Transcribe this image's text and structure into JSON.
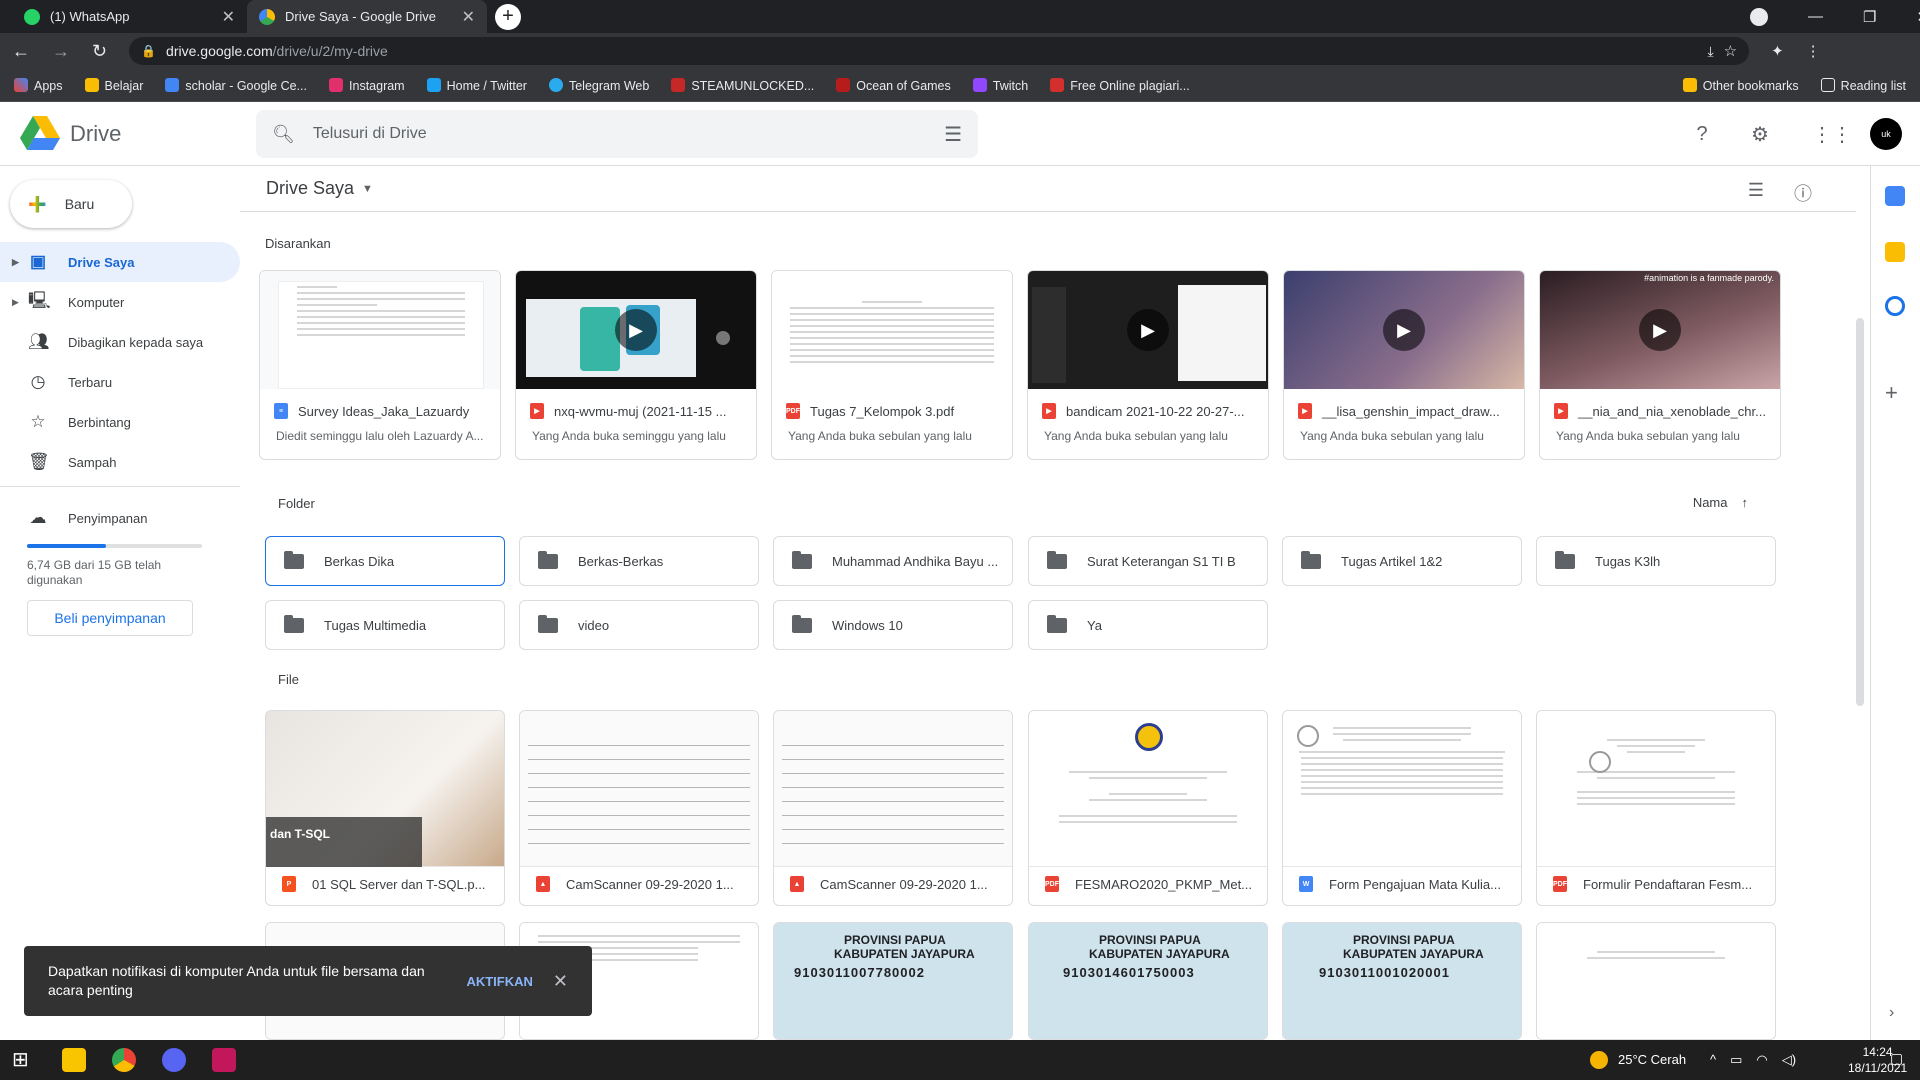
{
  "browser": {
    "tabs": [
      {
        "title": "(1) WhatsApp",
        "active": false
      },
      {
        "title": "Drive Saya - Google Drive",
        "active": true
      }
    ],
    "url_host": "drive.google.com",
    "url_path": "/drive/u/2/my-drive",
    "bookmarks": [
      "Apps",
      "Belajar",
      "scholar - Google Ce...",
      "Instagram",
      "Home / Twitter",
      "Telegram Web",
      "STEAMUNLOCKED...",
      "Ocean of Games",
      "Twitch",
      "Free Online plagiari..."
    ],
    "bookmarks_right": [
      "Other bookmarks",
      "Reading list"
    ]
  },
  "drive": {
    "app_name": "Drive",
    "search_placeholder": "Telusuri di Drive",
    "avatar_text": "uk",
    "new_label": "Baru",
    "nav": [
      "Drive Saya",
      "Komputer",
      "Dibagikan kepada saya",
      "Terbaru",
      "Berbintang",
      "Sampah"
    ],
    "storage_label": "Penyimpanan",
    "storage_text": "6,74 GB dari 15 GB telah digunakan",
    "storage_fraction": 0.45,
    "buy_label": "Beli penyimpanan",
    "crumb": "Drive Saya",
    "section_suggested": "Disarankan",
    "section_folder": "Folder",
    "section_file": "File",
    "sort_label": "Nama",
    "suggested": [
      {
        "name": "Survey Ideas_Jaka_Lazuardy",
        "sub": "Diedit seminggu lalu oleh Lazuardy A...",
        "type": "doc"
      },
      {
        "name": "nxq-wvmu-muj (2021-11-15 ...",
        "sub": "Yang Anda buka seminggu yang lalu",
        "type": "video"
      },
      {
        "name": "Tugas 7_Kelompok 3.pdf",
        "sub": "Yang Anda buka sebulan yang lalu",
        "type": "pdf"
      },
      {
        "name": "bandicam 2021-10-22 20-27-...",
        "sub": "Yang Anda buka sebulan yang lalu",
        "type": "video"
      },
      {
        "name": "__lisa_genshin_impact_draw...",
        "sub": "Yang Anda buka sebulan yang lalu",
        "type": "video"
      },
      {
        "name": "__nia_and_nia_xenoblade_chr...",
        "sub": "Yang Anda buka sebulan yang lalu",
        "type": "video"
      }
    ],
    "suggested_overlay_text": "#animation is a fanmade parody.",
    "folders": [
      "Berkas Dika",
      "Berkas-Berkas",
      "Muhammad Andhika Bayu ...",
      "Surat Keterangan S1 TI B",
      "Tugas Artikel 1&2",
      "Tugas K3lh",
      "Tugas Multimedia",
      "video",
      "Windows 10",
      "Ya"
    ],
    "files": [
      {
        "name": "01 SQL Server dan T-SQL.p...",
        "type": "ppt"
      },
      {
        "name": "CamScanner 09-29-2020 1...",
        "type": "img"
      },
      {
        "name": "CamScanner 09-29-2020 1...",
        "type": "img"
      },
      {
        "name": "FESMARO2020_PKMP_Met...",
        "type": "pdf"
      },
      {
        "name": "Form Pengajuan Mata Kulia...",
        "type": "word"
      },
      {
        "name": "Formulir Pendaftaran Fesm...",
        "type": "pdf"
      }
    ],
    "file_thumb_text": "dan T-SQL",
    "id_card_province": "PROVINSI PAPUA",
    "id_card_city": "KABUPATEN JAYAPURA",
    "id_card_niks": [
      "9103011007780002",
      "9103014601750003",
      "9103011001020001"
    ]
  },
  "toast": {
    "message": "Dapatkan notifikasi di komputer Anda untuk file bersama dan acara penting",
    "action": "AKTIFKAN"
  },
  "taskbar": {
    "weather": "25°C Cerah",
    "time": "14:24",
    "date": "18/11/2021"
  },
  "colors": {
    "accent": "#1a73e8",
    "pdf": "#ea4335",
    "doc": "#4285f4",
    "ppt": "#f4511e"
  }
}
